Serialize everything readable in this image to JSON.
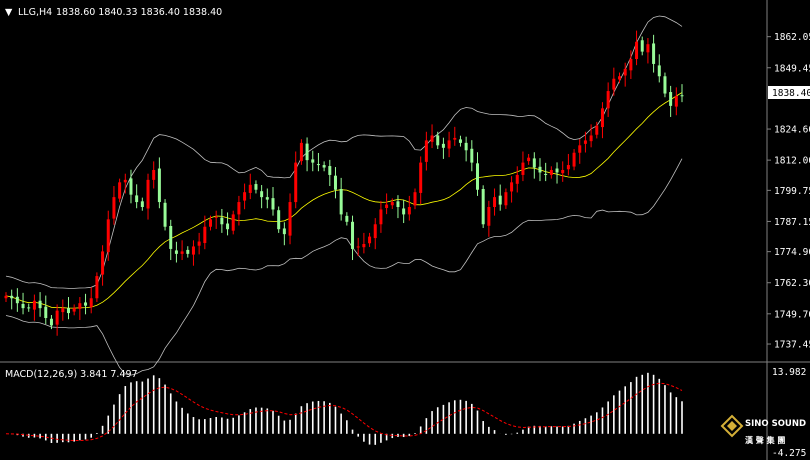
{
  "header": {
    "symbol_label": "LLG,H4",
    "ohlc_text": "1838.60 1840.33 1836.40 1838.40"
  },
  "price_axis": {
    "ticks": [
      "1862.05",
      "1849.45",
      "1824.60",
      "1812.00",
      "1799.75",
      "1787.15",
      "1774.90",
      "1762.30",
      "1749.70",
      "1737.45"
    ],
    "current_price_label": "1838.40"
  },
  "macd": {
    "label": "MACD(12,26,9) 3.841 7.497",
    "top_tick": "13.982",
    "bottom_tick": "-4.275"
  },
  "logo": {
    "brand": "SINO SOUND",
    "sub": "漢 聲 集 團"
  },
  "colors": {
    "background": "#000000",
    "bull": "#FF0000",
    "bear": "#98FB98",
    "bands": "#C0C0C0",
    "middle_band": "#FFFF00",
    "macd_hist": "#FFFFFF",
    "macd_signal": "#FF0000"
  },
  "chart_data": {
    "type": "candlestick",
    "indicator": "Bollinger Bands + MACD(12,26,9)",
    "ylim": [
      1733,
      1868
    ],
    "closes": [
      1757,
      1756,
      1754,
      1752,
      1752,
      1755,
      1752,
      1748,
      1745,
      1751,
      1752,
      1750,
      1752,
      1754,
      1753,
      1756,
      1765,
      1775,
      1788,
      1797,
      1803,
      1804,
      1798,
      1795,
      1793,
      1804,
      1808,
      1795,
      1785,
      1776,
      1774,
      1775,
      1774,
      1777,
      1779,
      1785,
      1788,
      1789,
      1786,
      1784,
      1790,
      1795,
      1799,
      1802,
      1800,
      1797,
      1796,
      1792,
      1784,
      1782,
      1795,
      1811,
      1819,
      1812,
      1811,
      1810,
      1809,
      1806,
      1800,
      1790,
      1787,
      1776,
      1777,
      1778,
      1781,
      1786,
      1792,
      1794,
      1795,
      1793,
      1790,
      1793,
      1799,
      1811,
      1820,
      1822,
      1818,
      1817,
      1820,
      1821,
      1819,
      1816,
      1811,
      1800,
      1786,
      1793,
      1797,
      1794,
      1799,
      1803,
      1806,
      1811,
      1813,
      1809,
      1807,
      1806,
      1808,
      1807,
      1808,
      1810,
      1815,
      1818,
      1820,
      1822,
      1826,
      1833,
      1840,
      1845,
      1846,
      1849,
      1853,
      1860,
      1856,
      1859,
      1851,
      1846,
      1839,
      1834,
      1838,
      1838
    ],
    "macd": {
      "histogram_range": [
        -4.275,
        13.982
      ],
      "last_main": 3.841,
      "last_signal": 7.497
    }
  }
}
